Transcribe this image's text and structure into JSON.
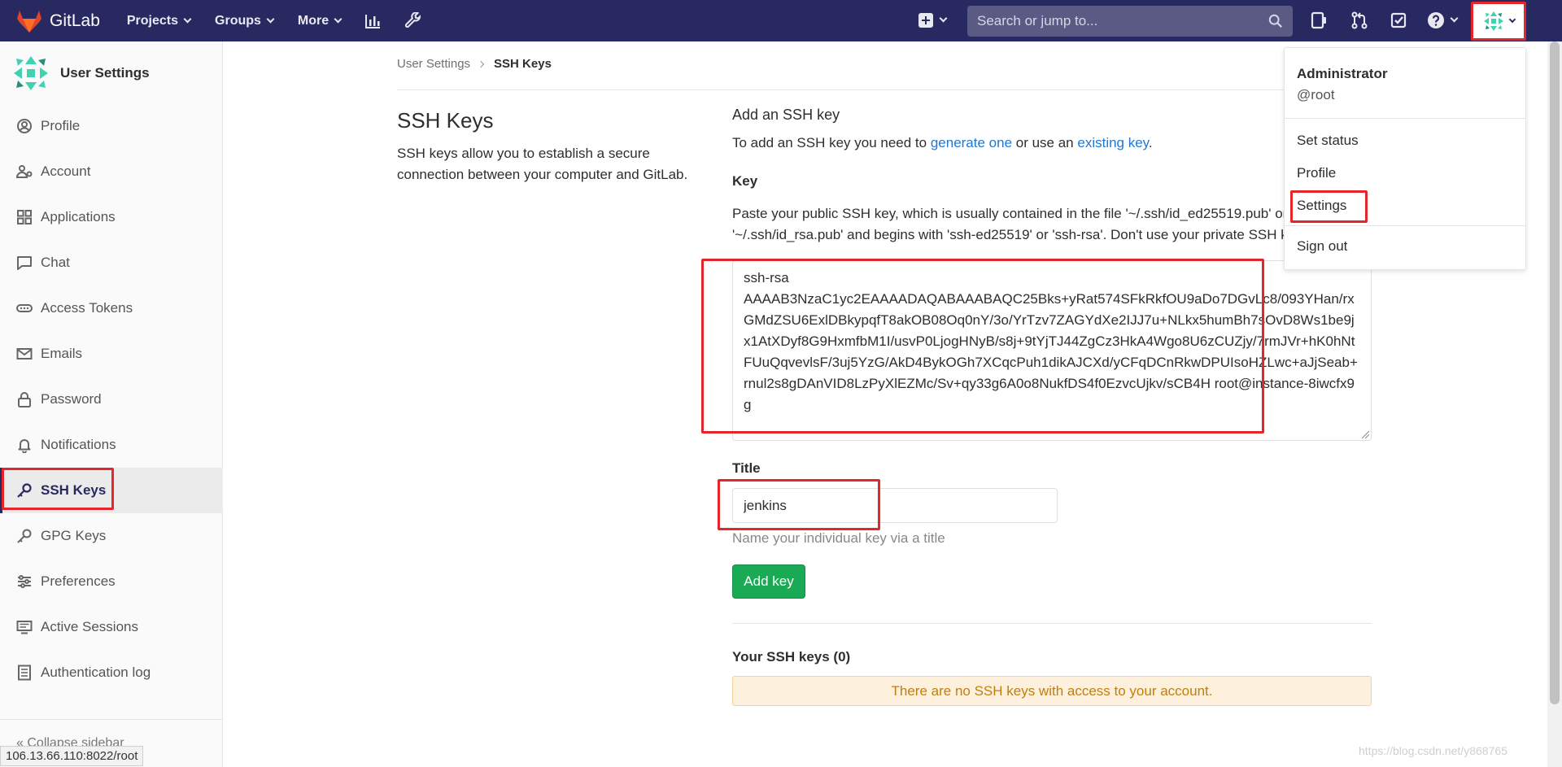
{
  "navbar": {
    "brand": "GitLab",
    "menus": [
      "Projects",
      "Groups",
      "More"
    ],
    "search_placeholder": "Search or jump to..."
  },
  "sidebar": {
    "title": "User Settings",
    "items": [
      {
        "label": "Profile",
        "icon": "profile-icon"
      },
      {
        "label": "Account",
        "icon": "account-icon"
      },
      {
        "label": "Applications",
        "icon": "applications-icon"
      },
      {
        "label": "Chat",
        "icon": "chat-icon"
      },
      {
        "label": "Access Tokens",
        "icon": "access-tokens-icon"
      },
      {
        "label": "Emails",
        "icon": "email-icon"
      },
      {
        "label": "Password",
        "icon": "lock-icon"
      },
      {
        "label": "Notifications",
        "icon": "bell-icon"
      },
      {
        "label": "SSH Keys",
        "icon": "key-icon",
        "active": true
      },
      {
        "label": "GPG Keys",
        "icon": "key-icon"
      },
      {
        "label": "Preferences",
        "icon": "preferences-icon"
      },
      {
        "label": "Active Sessions",
        "icon": "monitor-icon"
      },
      {
        "label": "Authentication log",
        "icon": "log-icon"
      }
    ],
    "collapse_label": "Collapse sidebar"
  },
  "status_url": "106.13.66.110:8022/root",
  "breadcrumb": {
    "parent": "User Settings",
    "current": "SSH Keys"
  },
  "page": {
    "title": "SSH Keys",
    "description": "SSH keys allow you to establish a secure connection between your computer and GitLab."
  },
  "form": {
    "heading": "Add an SSH key",
    "intro_prefix": "To add an SSH key you need to ",
    "intro_link1": "generate one",
    "intro_mid": " or use an ",
    "intro_link2": "existing key",
    "intro_suffix": ".",
    "key_label": "Key",
    "key_help_line1": "Paste your public SSH key, which is usually contained in the file '~/.ssh/id_ed25519.pub' or",
    "key_help_line2": "'~/.ssh/id_rsa.pub' and begins with 'ssh-ed25519' or 'ssh-rsa'. Don't use your private SSH key.",
    "key_value": "ssh-rsa\nAAAAB3NzaC1yc2EAAAADAQABAAABAQC25Bks+yRat574SFkRkfOU9aDo7DGvLc8/093YHan/rxGMdZSU6ExlDBkypqfT8akOB08Oq0nY/3o/YrTzv7ZAGYdXe2IJJ7u+NLkx5humBh7sOvD8Ws1be9jx1AtXDyf8G9HxmfbM1I/usvP0LjogHNyB/s8j+9tYjTJ44ZgCz3HkA4Wgo8U6zCUZjy/7rmJVr+hK0hNtFUuQqvevlsF/3uj5YzG/AkD4BykOGh7XCqcPuh1dikAJCXd/yCFqDCnRkwDPUIsoHZLwc+aJjSeab+rnul2s8gDAnVID8LzPyXlEZMc/Sv+qy33g6A0o8NukfDS4f0EzvcUjkv/sCB4H root@instance-8iwcfx9g",
    "title_label": "Title",
    "title_value": "jenkins",
    "title_help": "Name your individual key via a title",
    "submit_label": "Add key"
  },
  "keys_list": {
    "heading": "Your SSH keys (0)",
    "empty_message": "There are no SSH keys with access to your account."
  },
  "user_menu": {
    "name": "Administrator",
    "handle": "@root",
    "set_status": "Set status",
    "profile": "Profile",
    "settings": "Settings",
    "sign_out": "Sign out"
  },
  "watermark": "https://blog.csdn.net/y868765",
  "colors": {
    "navbar": "#292961",
    "accent_green": "#1aaa55",
    "link": "#1f78d1",
    "annotation_red": "#e4262a",
    "warning_bg": "#fdf1dd"
  }
}
